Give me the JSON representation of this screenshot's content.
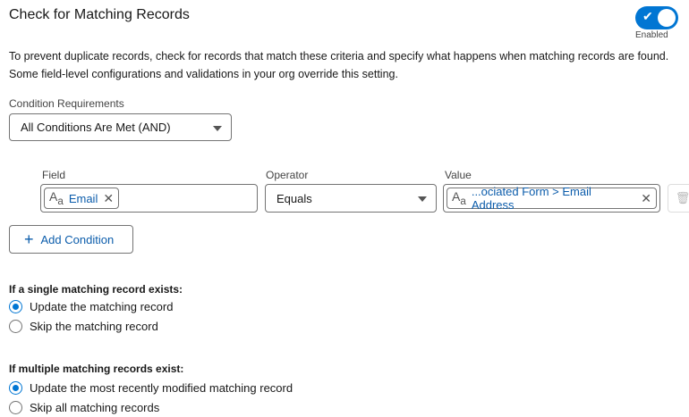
{
  "title": "Check for Matching Records",
  "toggle": {
    "label": "Enabled",
    "on": true
  },
  "description": "To prevent duplicate records, check for records that match these criteria and specify what happens when matching records are found. Some field-level configurations and validations in your org override this setting.",
  "condition_requirements": {
    "label": "Condition Requirements",
    "value": "All Conditions Are Met (AND)"
  },
  "condition": {
    "field_label": "Field",
    "field_value": "Email",
    "operator_label": "Operator",
    "operator_value": "Equals",
    "value_label": "Value",
    "value_value": "...ociated Form > Email Address"
  },
  "add_condition": "Add Condition",
  "single": {
    "heading": "If a single matching record exists:",
    "options": [
      "Update the matching record",
      "Skip the matching record"
    ],
    "selected": 0
  },
  "multiple": {
    "heading": "If multiple matching records exist:",
    "options": [
      "Update the most recently modified matching record",
      "Skip all matching records"
    ],
    "selected": 0
  },
  "colors": {
    "accent": "#0176d3",
    "link": "#0b5cab"
  }
}
